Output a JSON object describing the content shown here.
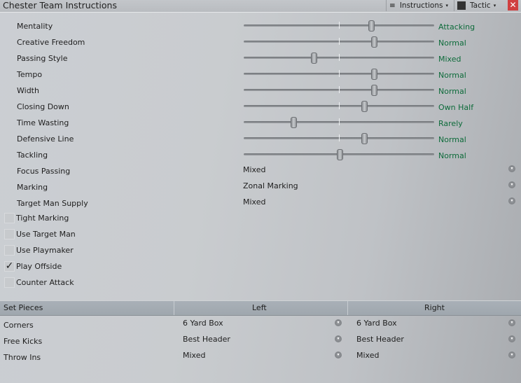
{
  "header": {
    "title": "Chester Team Instructions",
    "instructions_label": "Instructions",
    "tactic_label": "Tactic",
    "caret": "▾",
    "close": "✕",
    "instructions_icon": "≡"
  },
  "sliders": [
    {
      "label": "Mentality",
      "value": "Attacking",
      "position": 0.665
    },
    {
      "label": "Creative Freedom",
      "value": "Normal",
      "position": 0.68
    },
    {
      "label": "Passing Style",
      "value": "Mixed",
      "position": 0.364
    },
    {
      "label": "Tempo",
      "value": "Normal",
      "position": 0.68
    },
    {
      "label": "Width",
      "value": "Normal",
      "position": 0.68
    },
    {
      "label": "Closing Down",
      "value": "Own Half",
      "position": 0.63
    },
    {
      "label": "Time Wasting",
      "value": "Rarely",
      "position": 0.257
    },
    {
      "label": "Defensive Line",
      "value": "Normal",
      "position": 0.63
    },
    {
      "label": "Tackling",
      "value": "Normal",
      "position": 0.5
    }
  ],
  "dropdowns": [
    {
      "label": "Focus Passing",
      "value": "Mixed"
    },
    {
      "label": "Marking",
      "value": "Zonal Marking"
    },
    {
      "label": "Target Man Supply",
      "value": "Mixed"
    }
  ],
  "checkboxes": [
    {
      "label": "Tight Marking",
      "checked": false
    },
    {
      "label": "Use Target Man",
      "checked": false
    },
    {
      "label": "Use Playmaker",
      "checked": false
    },
    {
      "label": "Play Offside",
      "checked": true
    },
    {
      "label": "Counter Attack",
      "checked": false
    }
  ],
  "set_pieces": {
    "headers": [
      "Set Pieces",
      "Left",
      "Right"
    ],
    "rows": [
      {
        "label": "Corners",
        "left": "6 Yard Box",
        "right": "6 Yard Box"
      },
      {
        "label": "Free Kicks",
        "left": "Best Header",
        "right": "Best Header"
      },
      {
        "label": "Throw Ins",
        "left": "Mixed",
        "right": "Mixed"
      }
    ]
  },
  "check_glyph": "✓",
  "dropdown_glyph": "▾"
}
